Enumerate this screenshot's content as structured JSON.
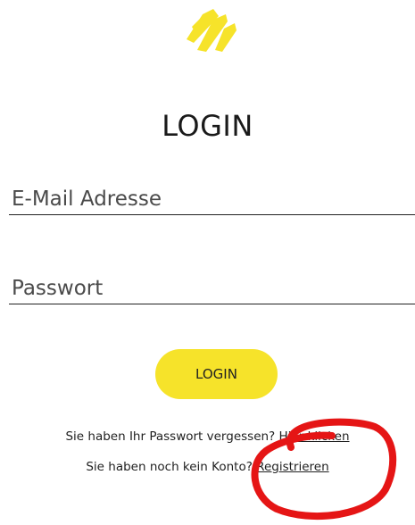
{
  "colors": {
    "brand_yellow": "#f6e32a",
    "text": "#1f1f1f",
    "annotation_red": "#e51515"
  },
  "logo": {
    "icon": "brand-logo-icon"
  },
  "login": {
    "title": "LOGIN",
    "email_placeholder": "E-Mail Adresse",
    "password_placeholder": "Passwort",
    "button_label": "LOGIN"
  },
  "links": {
    "forgot_text": "Sie haben Ihr Passwort vergessen?",
    "forgot_link": "Hier klicken",
    "register_text": "Sie haben noch kein Konto?",
    "register_link": "Registrieren"
  },
  "annotation": {
    "icon": "red-circle-annotation-icon"
  }
}
